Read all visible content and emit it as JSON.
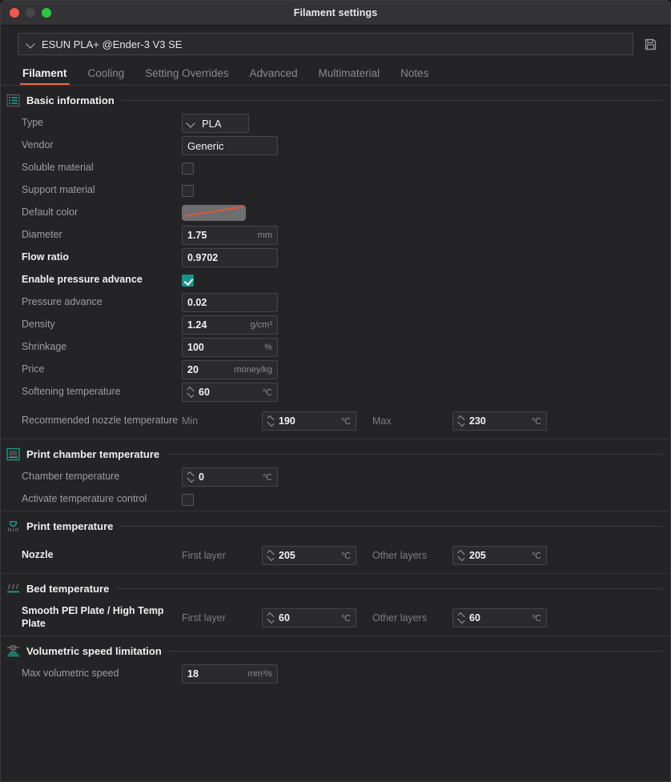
{
  "window": {
    "title": "Filament settings",
    "traffic_lights": [
      "close-red",
      "minimize-gray",
      "maximize-green"
    ]
  },
  "profile": {
    "name": "ESUN PLA+ @Ender-3 V3 SE",
    "save_icon": "floppy-disk-save-icon"
  },
  "tabs": [
    {
      "label": "Filament",
      "active": true
    },
    {
      "label": "Cooling",
      "active": false
    },
    {
      "label": "Setting Overrides",
      "active": false
    },
    {
      "label": "Advanced",
      "active": false
    },
    {
      "label": "Multimaterial",
      "active": false
    },
    {
      "label": "Notes",
      "active": false
    }
  ],
  "sections": {
    "basic": {
      "title": "Basic information",
      "icon": "list-info-icon",
      "type": {
        "label": "Type",
        "value": "PLA"
      },
      "vendor": {
        "label": "Vendor",
        "value": "Generic"
      },
      "soluble": {
        "label": "Soluble material",
        "checked": false
      },
      "support": {
        "label": "Support material",
        "checked": false
      },
      "default_color": {
        "label": "Default color",
        "swatch": "#6e6e70",
        "line_color": "#e0563a"
      },
      "diameter": {
        "label": "Diameter",
        "value": "1.75",
        "unit": "mm"
      },
      "flow_ratio": {
        "label": "Flow ratio",
        "value": "0.9702",
        "unit": ""
      },
      "enable_pa": {
        "label": "Enable pressure advance",
        "checked": true
      },
      "pressure_advance": {
        "label": "Pressure advance",
        "value": "0.02",
        "unit": ""
      },
      "density": {
        "label": "Density",
        "value": "1.24",
        "unit": "g/cm³"
      },
      "shrinkage": {
        "label": "Shrinkage",
        "value": "100",
        "unit": "%"
      },
      "price": {
        "label": "Price",
        "value": "20",
        "unit": "money/kg"
      },
      "softening": {
        "label": "Softening temperature",
        "value": "60",
        "unit": "℃"
      },
      "rec_nozzle": {
        "label": "Recommended nozzle temperature",
        "min_label": "Min",
        "min_value": "190",
        "min_unit": "℃",
        "max_label": "Max",
        "max_value": "230",
        "max_unit": "℃"
      }
    },
    "chamber": {
      "title": "Print chamber temperature",
      "icon": "chamber-icon",
      "chamber_temp": {
        "label": "Chamber temperature",
        "value": "0",
        "unit": "℃"
      },
      "activate_control": {
        "label": "Activate temperature control",
        "checked": false
      }
    },
    "print_temp": {
      "title": "Print temperature",
      "icon": "nozzle-icon",
      "nozzle": {
        "label": "Nozzle",
        "first_label": "First layer",
        "first_value": "205",
        "first_unit": "℃",
        "other_label": "Other layers",
        "other_value": "205",
        "other_unit": "℃"
      }
    },
    "bed_temp": {
      "title": "Bed temperature",
      "icon": "bed-heat-icon",
      "plate": {
        "label": "Smooth PEI Plate / High Temp Plate",
        "first_label": "First layer",
        "first_value": "60",
        "first_unit": "℃",
        "other_label": "Other layers",
        "other_value": "60",
        "other_unit": "℃"
      }
    },
    "volumetric": {
      "title": "Volumetric speed limitation",
      "icon": "extruder-speed-icon",
      "max_speed": {
        "label": "Max volumetric speed",
        "value": "18",
        "unit": "mm³/s"
      }
    }
  },
  "colors": {
    "accent_tab": "#f3634a",
    "accent_icon": "#1aa08f",
    "checkbox_on": "#159487",
    "window_bg": "#242426"
  }
}
